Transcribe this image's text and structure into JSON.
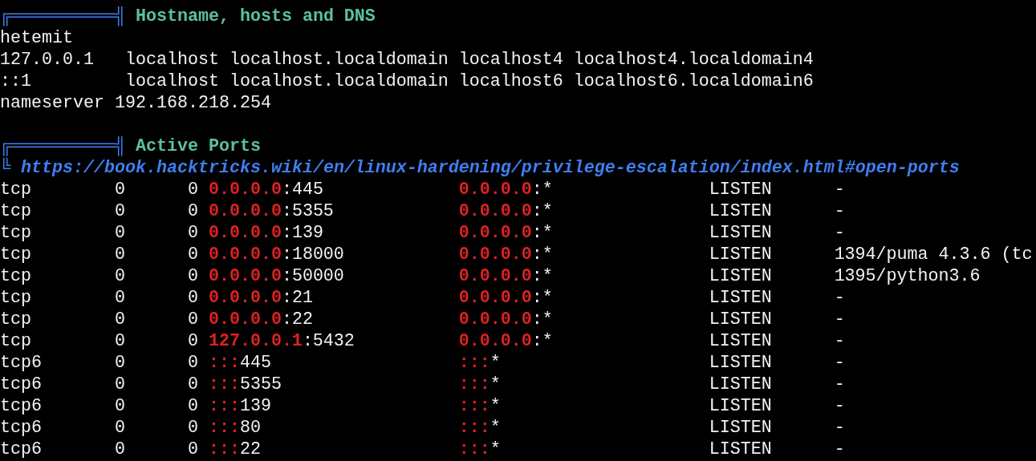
{
  "sections": [
    {
      "rule": "╔══════════╣",
      "title": "Hostname, hosts and DNS",
      "lines": [
        "hetemit",
        "127.0.0.1   localhost localhost.localdomain localhost4 localhost4.localdomain4",
        "::1         localhost localhost.localdomain localhost6 localhost6.localdomain6",
        "nameserver 192.168.218.254"
      ]
    },
    {
      "rule": "╔══════════╣",
      "title": "Active Ports",
      "link_mark": "╚",
      "link": "https://book.hacktricks.wiki/en/linux-hardening/privilege-escalation/index.html#open-ports",
      "ports": [
        {
          "proto": "tcp",
          "recv_q": "0",
          "send_q": "0",
          "local_host": "0.0.0.0",
          "local_port": ":445",
          "foreign_host": "0.0.0.0",
          "foreign_port": ":*",
          "state": "LISTEN",
          "process": "-"
        },
        {
          "proto": "tcp",
          "recv_q": "0",
          "send_q": "0",
          "local_host": "0.0.0.0",
          "local_port": ":5355",
          "foreign_host": "0.0.0.0",
          "foreign_port": ":*",
          "state": "LISTEN",
          "process": "-"
        },
        {
          "proto": "tcp",
          "recv_q": "0",
          "send_q": "0",
          "local_host": "0.0.0.0",
          "local_port": ":139",
          "foreign_host": "0.0.0.0",
          "foreign_port": ":*",
          "state": "LISTEN",
          "process": "-"
        },
        {
          "proto": "tcp",
          "recv_q": "0",
          "send_q": "0",
          "local_host": "0.0.0.0",
          "local_port": ":18000",
          "foreign_host": "0.0.0.0",
          "foreign_port": ":*",
          "state": "LISTEN",
          "process": "1394/puma 4.3.6 (tc"
        },
        {
          "proto": "tcp",
          "recv_q": "0",
          "send_q": "0",
          "local_host": "0.0.0.0",
          "local_port": ":50000",
          "foreign_host": "0.0.0.0",
          "foreign_port": ":*",
          "state": "LISTEN",
          "process": "1395/python3.6"
        },
        {
          "proto": "tcp",
          "recv_q": "0",
          "send_q": "0",
          "local_host": "0.0.0.0",
          "local_port": ":21",
          "foreign_host": "0.0.0.0",
          "foreign_port": ":*",
          "state": "LISTEN",
          "process": "-"
        },
        {
          "proto": "tcp",
          "recv_q": "0",
          "send_q": "0",
          "local_host": "0.0.0.0",
          "local_port": ":22",
          "foreign_host": "0.0.0.0",
          "foreign_port": ":*",
          "state": "LISTEN",
          "process": "-"
        },
        {
          "proto": "tcp",
          "recv_q": "0",
          "send_q": "0",
          "local_host": "127.0.0.1",
          "local_port": ":5432",
          "foreign_host": "0.0.0.0",
          "foreign_port": ":*",
          "state": "LISTEN",
          "process": "-"
        },
        {
          "proto": "tcp6",
          "recv_q": "0",
          "send_q": "0",
          "local_host": ":::",
          "local_port": "445",
          "foreign_host": ":::",
          "foreign_port": "*",
          "state": "LISTEN",
          "process": "-"
        },
        {
          "proto": "tcp6",
          "recv_q": "0",
          "send_q": "0",
          "local_host": ":::",
          "local_port": "5355",
          "foreign_host": ":::",
          "foreign_port": "*",
          "state": "LISTEN",
          "process": "-"
        },
        {
          "proto": "tcp6",
          "recv_q": "0",
          "send_q": "0",
          "local_host": ":::",
          "local_port": "139",
          "foreign_host": ":::",
          "foreign_port": "*",
          "state": "LISTEN",
          "process": "-"
        },
        {
          "proto": "tcp6",
          "recv_q": "0",
          "send_q": "0",
          "local_host": ":::",
          "local_port": "80",
          "foreign_host": ":::",
          "foreign_port": "*",
          "state": "LISTEN",
          "process": "-"
        },
        {
          "proto": "tcp6",
          "recv_q": "0",
          "send_q": "0",
          "local_host": ":::",
          "local_port": "22",
          "foreign_host": ":::",
          "foreign_port": "*",
          "state": "LISTEN",
          "process": "-"
        }
      ]
    }
  ]
}
